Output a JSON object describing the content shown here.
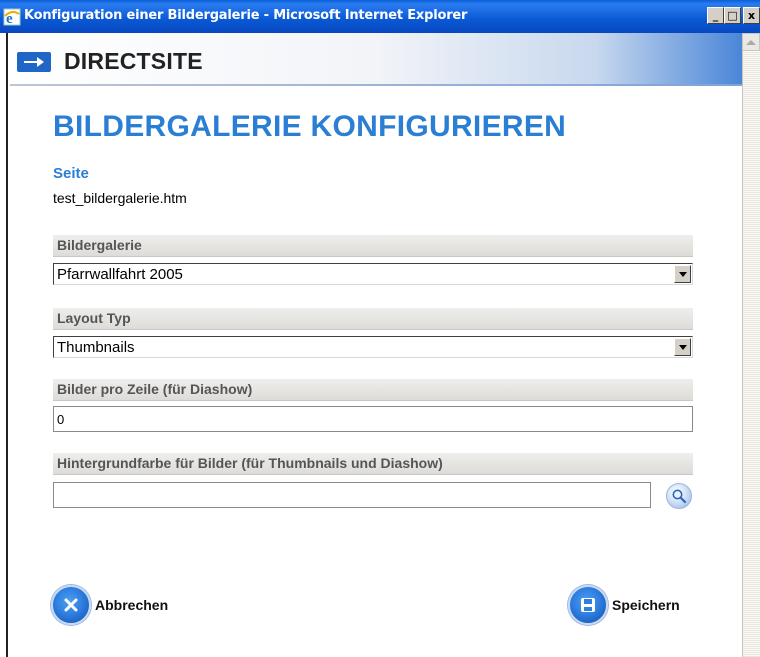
{
  "window": {
    "title": "Konfiguration einer Bildergalerie - Microsoft Internet Explorer",
    "minimize_label": "_",
    "maximize_label": "□",
    "close_label": "x"
  },
  "header": {
    "brand": "DIRECTSITE"
  },
  "main": {
    "title": "BILDERGALERIE KONFIGURIEREN",
    "page_section": {
      "label": "Seite",
      "value": "test_bildergalerie.htm"
    },
    "fields": {
      "gallery": {
        "label": "Bildergalerie",
        "selected": "Pfarrwallfahrt 2005"
      },
      "layout_type": {
        "label": "Layout Typ",
        "selected": "Thumbnails"
      },
      "images_per_row": {
        "label": "Bilder pro Zeile (für Diashow)",
        "value": "0"
      },
      "background_color": {
        "label": "Hintergrundfarbe für Bilder (für Thumbnails und Diashow)",
        "value": ""
      }
    }
  },
  "actions": {
    "cancel_label": "Abbrechen",
    "save_label": "Speichern"
  },
  "colors": {
    "accent": "#2a7fd4",
    "titlebar": "#0a58d4"
  }
}
